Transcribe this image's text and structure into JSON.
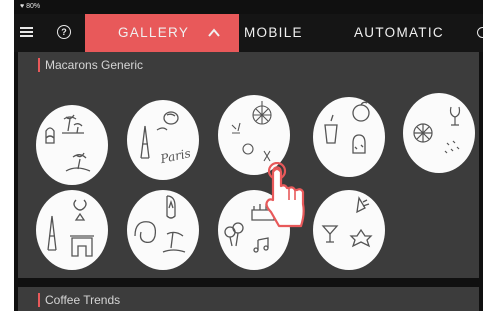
{
  "status_bar": {
    "battery": "80%"
  },
  "header": {
    "tabs": [
      {
        "label": "GALLERY",
        "active": true
      },
      {
        "label": "MOBILE",
        "active": false
      },
      {
        "label": "AUTOMATIC",
        "active": false
      }
    ],
    "accent_color": "#e8595a"
  },
  "sections": [
    {
      "title": "Macarons Generic",
      "items": [
        {
          "icon": "travel-icons"
        },
        {
          "icon": "paris-icons"
        },
        {
          "icon": "disco-party-icons"
        },
        {
          "icon": "tropical-drink-icons"
        },
        {
          "icon": "celebration-icons"
        },
        {
          "icon": "paris-monument-icons"
        },
        {
          "icon": "beach-icons"
        },
        {
          "icon": "birthday-icons"
        },
        {
          "icon": "cocktail-icons"
        }
      ]
    },
    {
      "title": "Coffee Trends"
    }
  ]
}
